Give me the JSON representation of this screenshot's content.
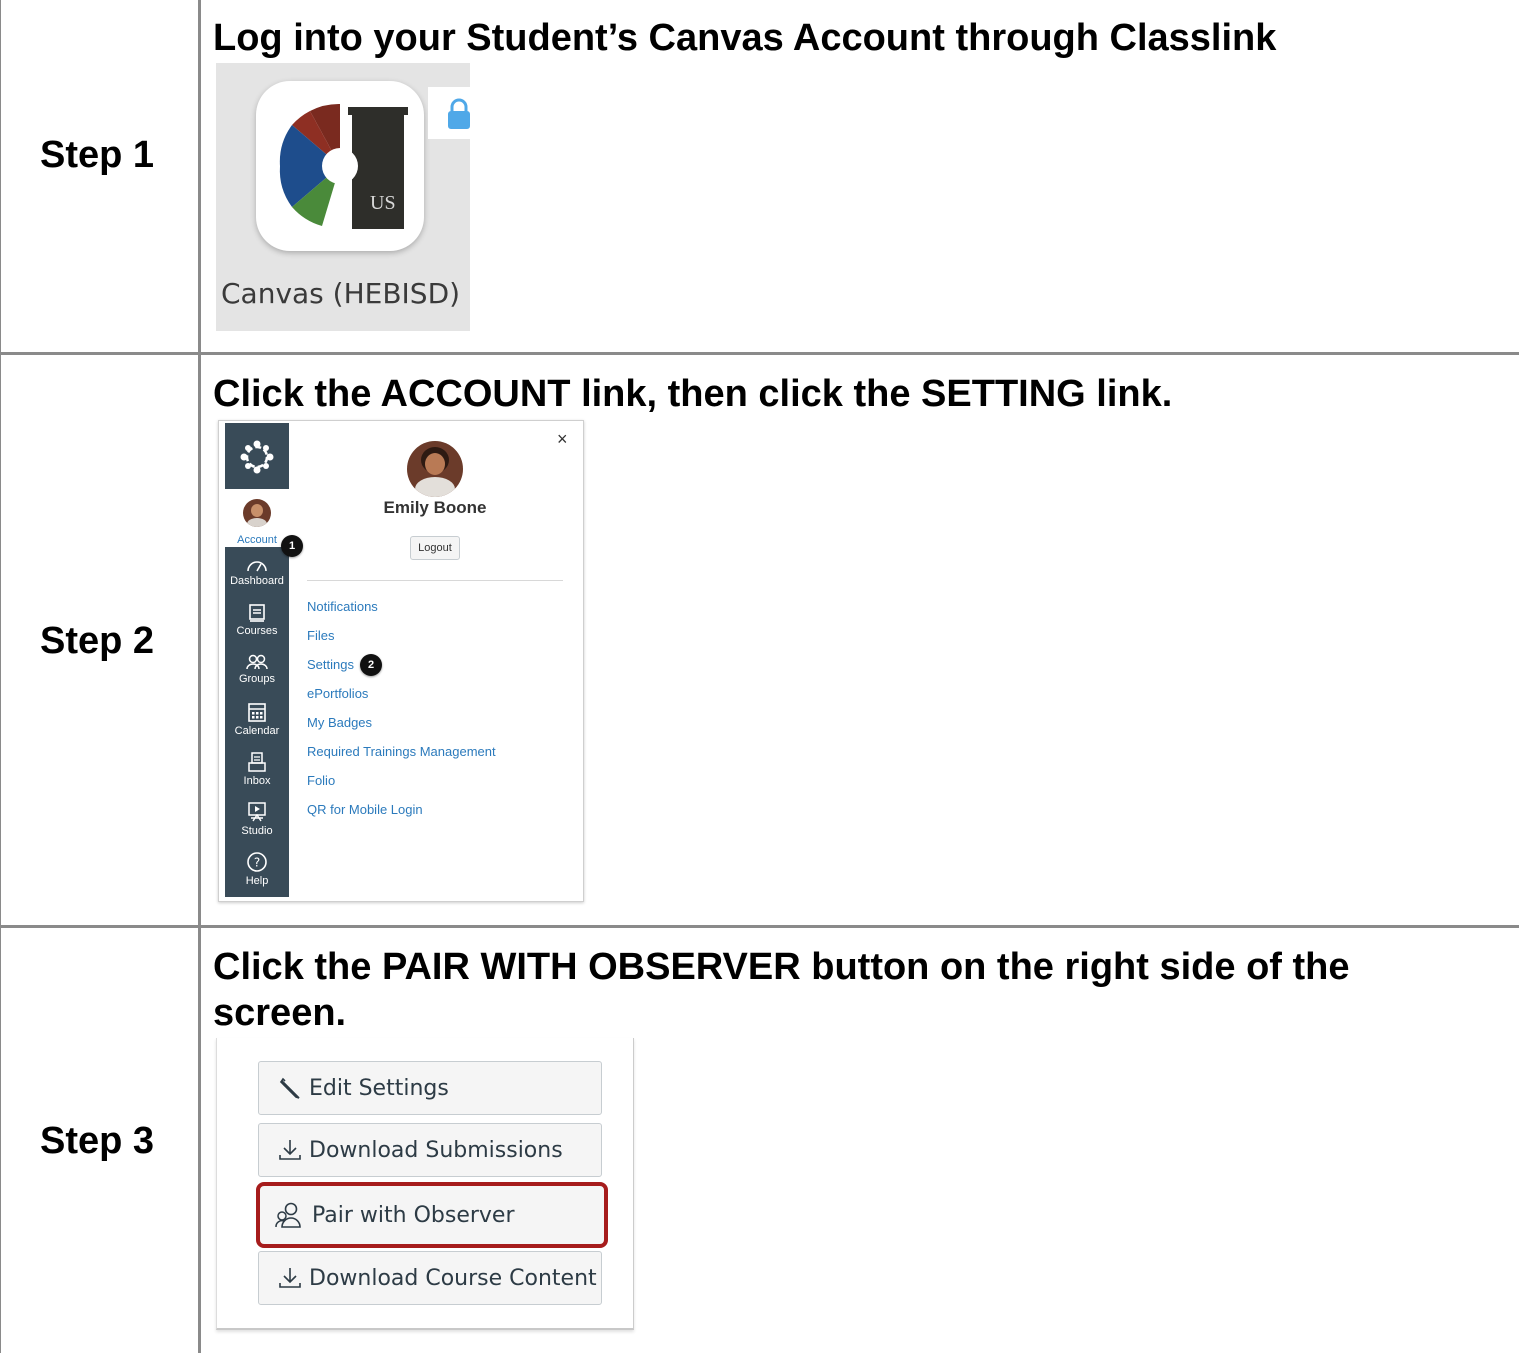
{
  "steps": [
    {
      "label": "Step 1",
      "instruction": "Log into your Student’s Canvas Account through Classlink"
    },
    {
      "label": "Step 2",
      "instruction": "Click the ACCOUNT link, then click the SETTING link."
    },
    {
      "label": "Step 3",
      "instruction": "Click the PAIR WITH OBSERVER button on the right side of the screen."
    }
  ],
  "app_tile": {
    "caption": "Canvas (HEBISD)",
    "logo_text": "US"
  },
  "account_panel": {
    "close_glyph": "×",
    "user_name": "Emily Boone",
    "logout_label": "Logout",
    "nav": {
      "account": "Account",
      "dashboard": "Dashboard",
      "courses": "Courses",
      "groups": "Groups",
      "calendar": "Calendar",
      "inbox": "Inbox",
      "studio": "Studio",
      "help": "Help"
    },
    "links": [
      "Notifications",
      "Files",
      "Settings",
      "ePortfolios",
      "My Badges",
      "Required Trainings Management",
      "Folio",
      "QR for Mobile Login"
    ],
    "badge1": "1",
    "badge2": "2"
  },
  "course_buttons": {
    "edit_settings": "Edit Settings",
    "download_submissions": "Download Submissions",
    "pair_with_observer": "Pair with Observer",
    "download_course_content": "Download Course Content"
  },
  "colors": {
    "grid_line": "#8a8a8a",
    "nav_bg": "#394b58",
    "link": "#2b7abc",
    "highlight": "#a61c1c"
  }
}
